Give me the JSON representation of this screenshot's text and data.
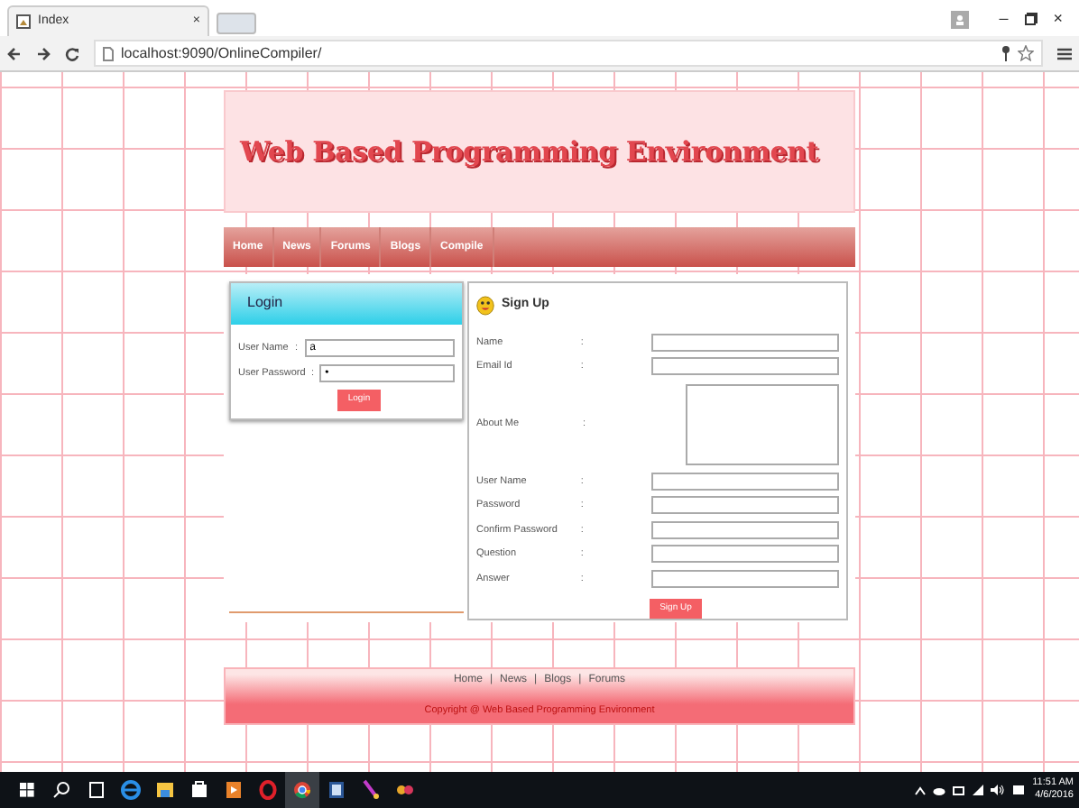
{
  "browser": {
    "tab_title": "Index",
    "close": "×",
    "url": "localhost:9090/OnlineCompiler/",
    "window_controls": [
      "–",
      "×"
    ]
  },
  "header": {
    "title": "Web Based Programming Environment"
  },
  "nav": [
    {
      "label": "Home"
    },
    {
      "label": "News"
    },
    {
      "label": "Forums"
    },
    {
      "label": "Blogs"
    },
    {
      "label": "Compile"
    }
  ],
  "login": {
    "title": "Login",
    "fields": [
      {
        "label": "User Name",
        "colon": ":",
        "value": "a"
      },
      {
        "label": "User Password",
        "colon": ":",
        "value": "•"
      }
    ],
    "button": "Login"
  },
  "signup": {
    "title": "Sign Up",
    "fields": [
      {
        "label": "Name",
        "colon": ":",
        "kind": "input"
      },
      {
        "label": "Email Id",
        "colon": ":",
        "kind": "input"
      },
      {
        "label": "About Me",
        "colon": ":",
        "kind": "textarea"
      },
      {
        "label": "User Name",
        "colon": ":",
        "kind": "input"
      },
      {
        "label": "Password",
        "colon": ":",
        "kind": "input"
      },
      {
        "label": "Confirm Password",
        "colon": ":",
        "kind": "input"
      },
      {
        "label": "Question",
        "colon": ":",
        "kind": "input"
      },
      {
        "label": "Answer",
        "colon": ":",
        "kind": "input"
      }
    ],
    "button": "Sign Up"
  },
  "footer": {
    "links": [
      "Home",
      "News",
      "Blogs",
      "Forums"
    ],
    "separator": "|",
    "copyright": "Copyright @ Web Based Programming Environment"
  },
  "taskbar": {
    "time": "11:51 AM",
    "date": "4/6/2016"
  }
}
